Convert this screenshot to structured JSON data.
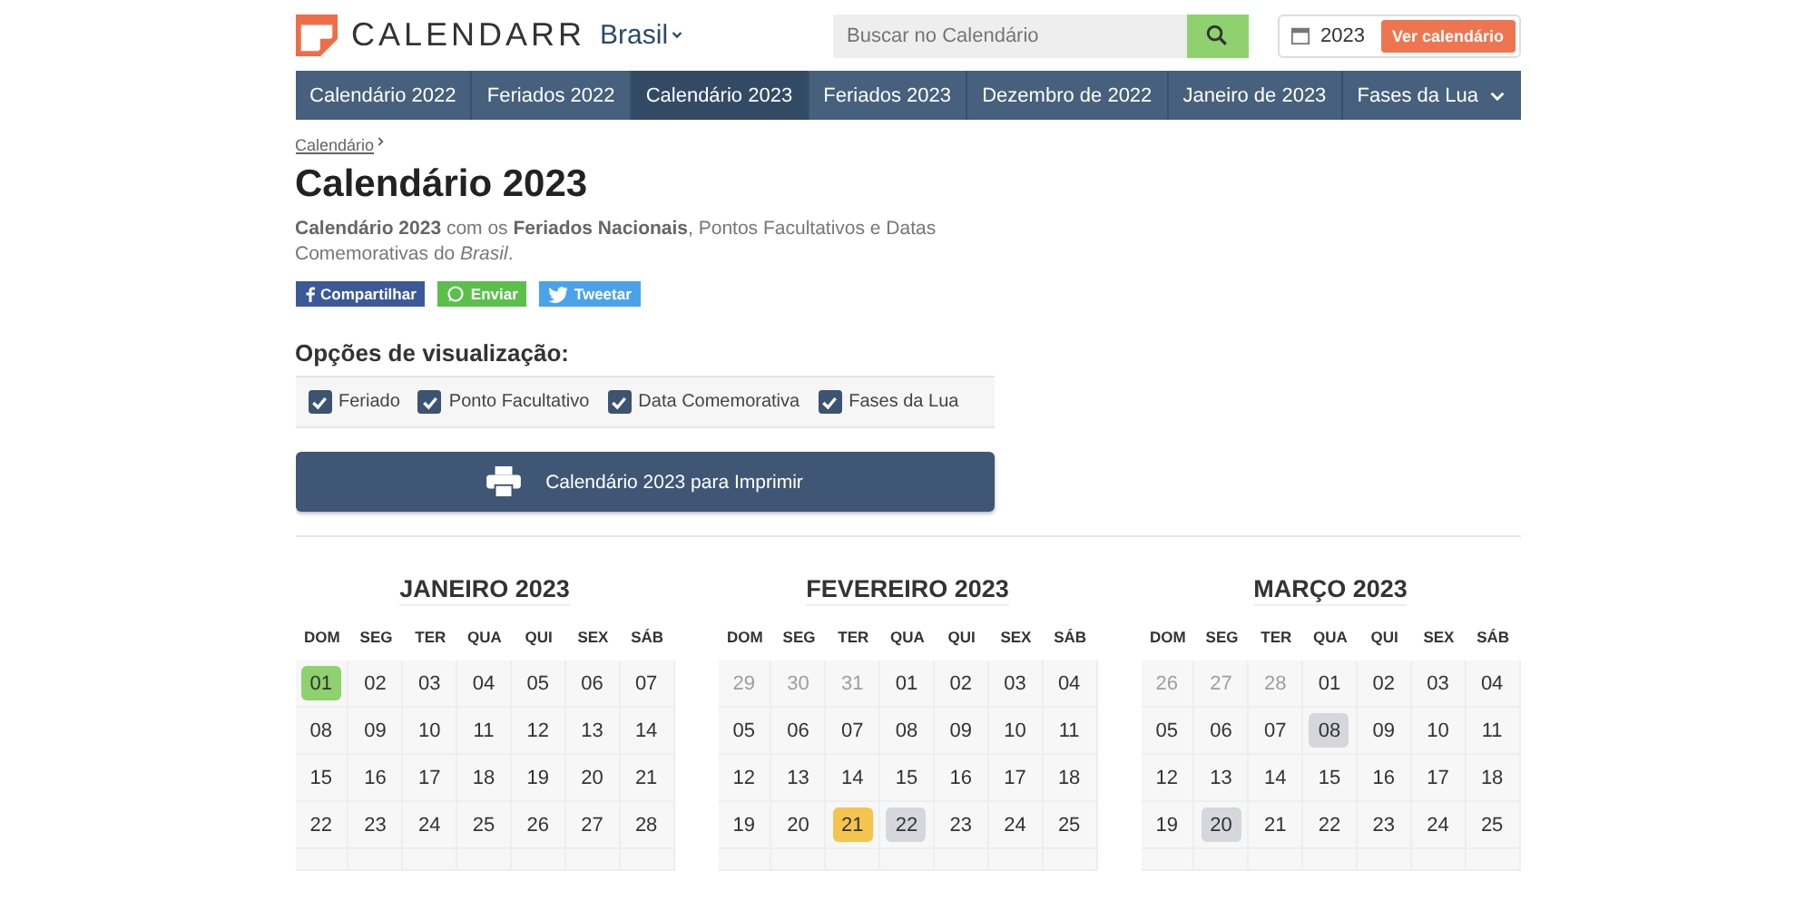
{
  "logo": {
    "name": "CALENDARR",
    "country": "Brasil"
  },
  "search": {
    "placeholder": "Buscar no Calendário"
  },
  "year_picker": {
    "value": "2023",
    "button": "Ver calendário"
  },
  "nav": [
    {
      "label": "Calendário 2022",
      "selected": false
    },
    {
      "label": "Feriados 2022",
      "selected": false
    },
    {
      "label": "Calendário 2023",
      "selected": true
    },
    {
      "label": "Feriados 2023",
      "selected": false
    },
    {
      "label": "Dezembro de 2022",
      "selected": false
    },
    {
      "label": "Janeiro de 2023",
      "selected": false
    },
    {
      "label": "Fases da Lua",
      "selected": false,
      "dropdown": true
    }
  ],
  "breadcrumb": "Calendário",
  "title": "Calendário 2023",
  "description": "**Calendário 2023** com os **Feriados Nacionais**, Pontos Facultativos e Datas Comemorativas do *Brasil*.",
  "share": [
    {
      "label": "Compartilhar",
      "kind": "facebook"
    },
    {
      "label": "Enviar",
      "kind": "whatsapp"
    },
    {
      "label": "Tweetar",
      "kind": "twitter"
    }
  ],
  "options": {
    "heading": "Opções de visualização:",
    "items": [
      {
        "label": "Feriado",
        "checked": true
      },
      {
        "label": "Ponto Facultativo",
        "checked": true
      },
      {
        "label": "Data Comemorativa",
        "checked": true
      },
      {
        "label": "Fases da Lua",
        "checked": true
      }
    ]
  },
  "print_button": "Calendário 2023 para Imprimir",
  "months": [
    {
      "title": "JANEIRO 2023",
      "weekdays": [
        "DOM",
        "SEG",
        "TER",
        "QUA",
        "QUI",
        "SEX",
        "SÁB"
      ],
      "weeks": [
        [
          {
            "d": "01",
            "kind": "holiday"
          },
          {
            "d": "02",
            "kind": "normal"
          },
          {
            "d": "03",
            "kind": "normal"
          },
          {
            "d": "04",
            "kind": "normal"
          },
          {
            "d": "05",
            "kind": "normal"
          },
          {
            "d": "06",
            "kind": "normal"
          },
          {
            "d": "07",
            "kind": "normal"
          }
        ],
        [
          {
            "d": "08",
            "kind": "normal"
          },
          {
            "d": "09",
            "kind": "normal"
          },
          {
            "d": "10",
            "kind": "normal"
          },
          {
            "d": "11",
            "kind": "normal"
          },
          {
            "d": "12",
            "kind": "normal"
          },
          {
            "d": "13",
            "kind": "normal"
          },
          {
            "d": "14",
            "kind": "normal"
          }
        ],
        [
          {
            "d": "15",
            "kind": "normal"
          },
          {
            "d": "16",
            "kind": "normal"
          },
          {
            "d": "17",
            "kind": "normal"
          },
          {
            "d": "18",
            "kind": "normal"
          },
          {
            "d": "19",
            "kind": "normal"
          },
          {
            "d": "20",
            "kind": "normal"
          },
          {
            "d": "21",
            "kind": "normal"
          }
        ],
        [
          {
            "d": "22",
            "kind": "normal"
          },
          {
            "d": "23",
            "kind": "normal"
          },
          {
            "d": "24",
            "kind": "normal"
          },
          {
            "d": "25",
            "kind": "normal"
          },
          {
            "d": "26",
            "kind": "normal"
          },
          {
            "d": "27",
            "kind": "normal"
          },
          {
            "d": "28",
            "kind": "normal"
          }
        ]
      ]
    },
    {
      "title": "FEVEREIRO 2023",
      "weekdays": [
        "DOM",
        "SEG",
        "TER",
        "QUA",
        "QUI",
        "SEX",
        "SÁB"
      ],
      "weeks": [
        [
          {
            "d": "29",
            "kind": "other"
          },
          {
            "d": "30",
            "kind": "other"
          },
          {
            "d": "31",
            "kind": "other"
          },
          {
            "d": "01",
            "kind": "normal"
          },
          {
            "d": "02",
            "kind": "normal"
          },
          {
            "d": "03",
            "kind": "normal"
          },
          {
            "d": "04",
            "kind": "normal"
          }
        ],
        [
          {
            "d": "05",
            "kind": "normal"
          },
          {
            "d": "06",
            "kind": "normal"
          },
          {
            "d": "07",
            "kind": "normal"
          },
          {
            "d": "08",
            "kind": "normal"
          },
          {
            "d": "09",
            "kind": "normal"
          },
          {
            "d": "10",
            "kind": "normal"
          },
          {
            "d": "11",
            "kind": "normal"
          }
        ],
        [
          {
            "d": "12",
            "kind": "normal"
          },
          {
            "d": "13",
            "kind": "normal"
          },
          {
            "d": "14",
            "kind": "normal"
          },
          {
            "d": "15",
            "kind": "normal"
          },
          {
            "d": "16",
            "kind": "normal"
          },
          {
            "d": "17",
            "kind": "normal"
          },
          {
            "d": "18",
            "kind": "normal"
          }
        ],
        [
          {
            "d": "19",
            "kind": "normal"
          },
          {
            "d": "20",
            "kind": "normal"
          },
          {
            "d": "21",
            "kind": "optional"
          },
          {
            "d": "22",
            "kind": "commemorative"
          },
          {
            "d": "23",
            "kind": "normal"
          },
          {
            "d": "24",
            "kind": "normal"
          },
          {
            "d": "25",
            "kind": "normal"
          }
        ]
      ]
    },
    {
      "title": "MARÇO 2023",
      "weekdays": [
        "DOM",
        "SEG",
        "TER",
        "QUA",
        "QUI",
        "SEX",
        "SÁB"
      ],
      "weeks": [
        [
          {
            "d": "26",
            "kind": "other"
          },
          {
            "d": "27",
            "kind": "other"
          },
          {
            "d": "28",
            "kind": "other"
          },
          {
            "d": "01",
            "kind": "normal"
          },
          {
            "d": "02",
            "kind": "normal"
          },
          {
            "d": "03",
            "kind": "normal"
          },
          {
            "d": "04",
            "kind": "normal"
          }
        ],
        [
          {
            "d": "05",
            "kind": "normal"
          },
          {
            "d": "06",
            "kind": "normal"
          },
          {
            "d": "07",
            "kind": "normal"
          },
          {
            "d": "08",
            "kind": "commemorative"
          },
          {
            "d": "09",
            "kind": "normal"
          },
          {
            "d": "10",
            "kind": "normal"
          },
          {
            "d": "11",
            "kind": "normal"
          }
        ],
        [
          {
            "d": "12",
            "kind": "normal"
          },
          {
            "d": "13",
            "kind": "normal"
          },
          {
            "d": "14",
            "kind": "normal"
          },
          {
            "d": "15",
            "kind": "normal"
          },
          {
            "d": "16",
            "kind": "normal"
          },
          {
            "d": "17",
            "kind": "normal"
          },
          {
            "d": "18",
            "kind": "normal"
          }
        ],
        [
          {
            "d": "19",
            "kind": "normal"
          },
          {
            "d": "20",
            "kind": "commemorative"
          },
          {
            "d": "21",
            "kind": "normal"
          },
          {
            "d": "22",
            "kind": "normal"
          },
          {
            "d": "23",
            "kind": "normal"
          },
          {
            "d": "24",
            "kind": "normal"
          },
          {
            "d": "25",
            "kind": "normal"
          }
        ]
      ]
    }
  ]
}
